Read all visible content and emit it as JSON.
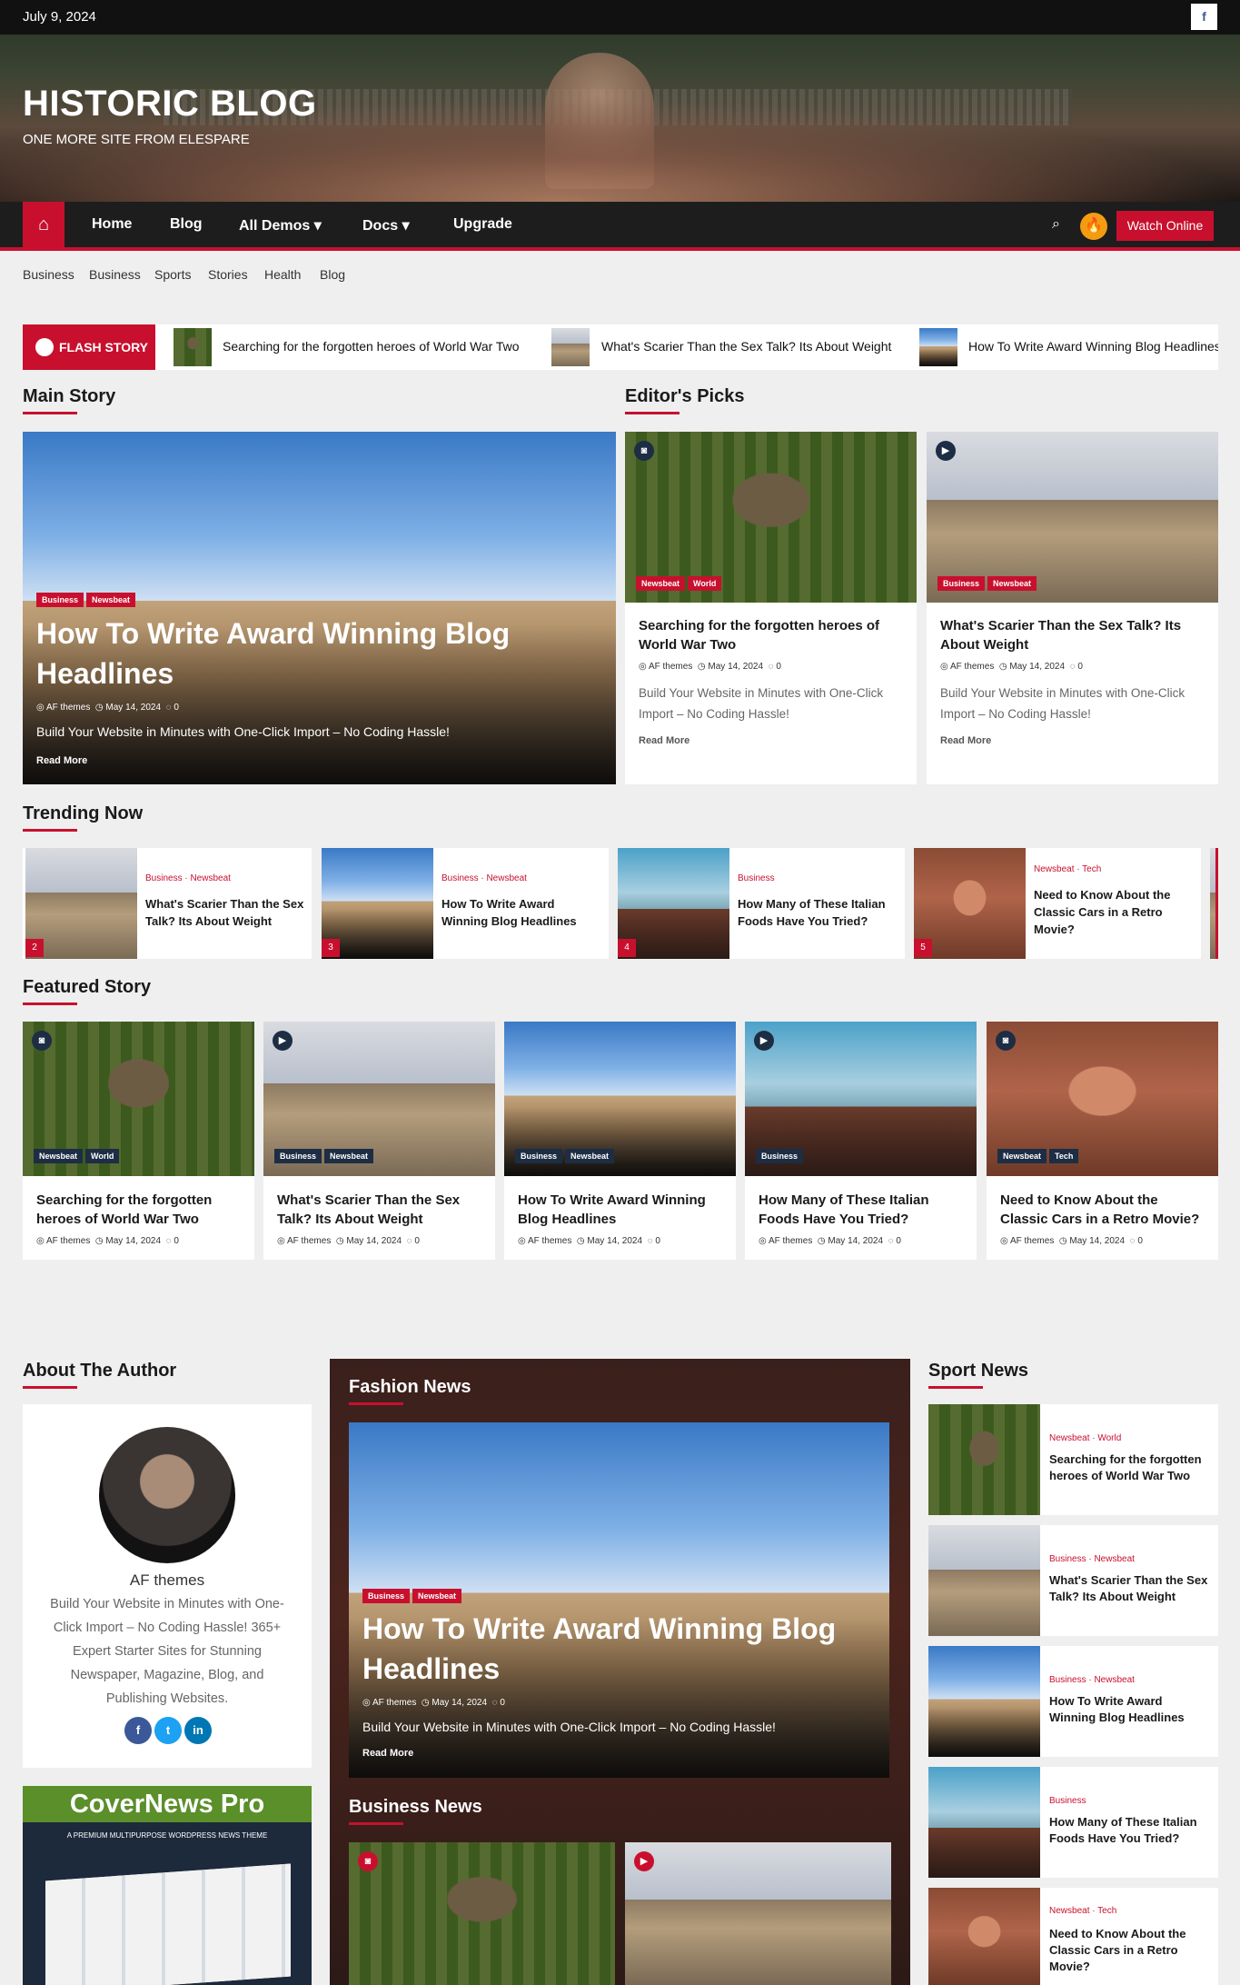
{
  "topbar": {
    "date": "July 9, 2024",
    "facebook_icon": "f"
  },
  "header": {
    "site_title": "HISTORIC BLOG",
    "tagline": "ONE MORE SITE FROM ELESPARE"
  },
  "nav": {
    "home_icon": "⌂",
    "items": [
      "Home",
      "Blog",
      "All Demos",
      "Docs",
      "Upgrade"
    ],
    "chevron": "▾",
    "search_icon": "⌕",
    "fire_icon": "🔥",
    "watch_label": "Watch Online"
  },
  "subnav": [
    "Business",
    "Business",
    "Sports",
    "Stories",
    "Health",
    "Blog"
  ],
  "flash": {
    "label": "FLASH STORY",
    "items": [
      "Searching for the forgotten heroes of World War Two",
      "What's Scarier Than the Sex Talk? Its About Weight",
      "How To Write Award Winning Blog Headlines"
    ]
  },
  "main_story": {
    "section_title": "Main Story",
    "badges": [
      "Business",
      "Newsbeat"
    ],
    "title": "How To Write Award Winning Blog Headlines",
    "author": "AF themes",
    "date": "May 14, 2024",
    "comments": "0",
    "excerpt": "Build Your Website in Minutes with One-Click Import – No Coding Hassle!",
    "read_more": "Read More"
  },
  "editors_picks": {
    "section_title": "Editor's Picks",
    "cards": [
      {
        "badges": [
          "Newsbeat",
          "World"
        ],
        "title": "Searching for the forgotten heroes of World War Two",
        "author": "AF themes",
        "date": "May 14, 2024",
        "comments": "0",
        "excerpt": "Build Your Website in Minutes with One-Click Import – No Coding Hassle!",
        "read_more": "Read More",
        "media_icon": "◙"
      },
      {
        "badges": [
          "Business",
          "Newsbeat"
        ],
        "title": "What's Scarier Than the Sex Talk? Its About Weight",
        "author": "AF themes",
        "date": "May 14, 2024",
        "comments": "0",
        "excerpt": "Build Your Website in Minutes with One-Click Import – No Coding Hassle!",
        "read_more": "Read More",
        "media_icon": "▶"
      }
    ]
  },
  "trending": {
    "section_title": "Trending Now",
    "items": [
      {
        "cats": "Business · Newsbeat",
        "title": "What's Scarier Than the Sex Talk? Its About Weight",
        "num": "2"
      },
      {
        "cats": "Business · Newsbeat",
        "title": "How To Write Award Winning Blog Headlines",
        "num": "3"
      },
      {
        "cats": "Business",
        "title": "How Many of These Italian Foods Have You Tried?",
        "num": "4"
      },
      {
        "cats": "Newsbeat · Tech",
        "title": "Need to Know About the Classic Cars in a Retro Movie?",
        "num": "5"
      }
    ]
  },
  "featured": {
    "section_title": "Featured Story",
    "cards": [
      {
        "badges": [
          "Newsbeat",
          "World"
        ],
        "title": "Searching for the forgotten heroes of World War Two",
        "author": "AF themes",
        "date": "May 14, 2024",
        "comments": "0"
      },
      {
        "badges": [
          "Business",
          "Newsbeat"
        ],
        "title": "What's Scarier Than the Sex Talk? Its About Weight",
        "author": "AF themes",
        "date": "May 14, 2024",
        "comments": "0"
      },
      {
        "badges": [
          "Business",
          "Newsbeat"
        ],
        "title": "How To Write Award Winning Blog Headlines",
        "author": "AF themes",
        "date": "May 14, 2024",
        "comments": "0"
      },
      {
        "badges": [
          "Business"
        ],
        "title": "How Many of These Italian Foods Have You Tried?",
        "author": "AF themes",
        "date": "May 14, 2024",
        "comments": "0"
      },
      {
        "badges": [
          "Newsbeat",
          "Tech"
        ],
        "title": "Need to Know About the Classic Cars in a Retro Movie?",
        "author": "AF themes",
        "date": "May 14, 2024",
        "comments": "0"
      }
    ]
  },
  "author": {
    "section_title": "About The Author",
    "name": "AF themes",
    "bio": "Build Your Website in Minutes with One-Click Import – No Coding Hassle! 365+ Expert Starter Sites for Stunning Newspaper, Magazine, Blog, and Publishing Websites.",
    "social": [
      "f",
      "t",
      "in"
    ]
  },
  "ad": {
    "title": "CoverNews Pro",
    "subtitle": "A PREMIUM MULTIPURPOSE WORDPRESS NEWS THEME"
  },
  "fashion": {
    "section_title": "Fashion News",
    "badges": [
      "Business",
      "Newsbeat"
    ],
    "title": "How To Write Award Winning Blog Headlines",
    "author": "AF themes",
    "date": "May 14, 2024",
    "comments": "0",
    "excerpt": "Build Your Website in Minutes with One-Click Import – No Coding Hassle!",
    "read_more": "Read More"
  },
  "business": {
    "section_title": "Business News"
  },
  "sport": {
    "section_title": "Sport News",
    "items": [
      {
        "cats": "Newsbeat · World",
        "title": "Searching for the forgotten heroes of World War Two"
      },
      {
        "cats": "Business · Newsbeat",
        "title": "What's Scarier Than the Sex Talk? Its About Weight"
      },
      {
        "cats": "Business · Newsbeat",
        "title": "How To Write Award Winning Blog Headlines"
      },
      {
        "cats": "Business",
        "title": "How Many of These Italian Foods Have You Tried?"
      },
      {
        "cats": "Newsbeat · Tech",
        "title": "Need to Know About the Classic Cars in a Retro Movie?"
      }
    ]
  },
  "colors": {
    "accent": "#c8102e",
    "dark": "#1d1d1d",
    "badge_dark": "#1d2d44"
  },
  "meta_icons": {
    "author": "◎",
    "date": "◷",
    "comments": "◌"
  }
}
